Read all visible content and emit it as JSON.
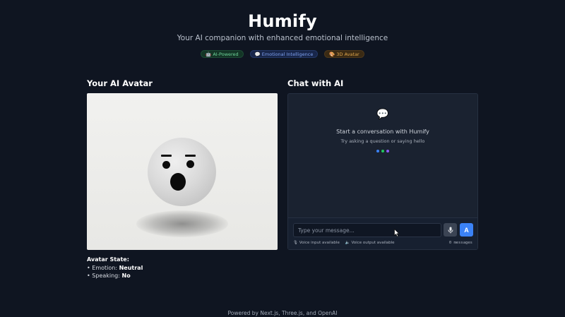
{
  "header": {
    "title": "Humify",
    "subtitle": "Your AI companion with enhanced emotional intelligence",
    "badges": [
      {
        "icon": "robot-icon",
        "glyph": "🤖",
        "label": "AI-Powered",
        "color": "#6fd39a"
      },
      {
        "icon": "speech-bubble-icon",
        "glyph": "💬",
        "label": "Emotional Intelligence",
        "color": "#7fa2f0"
      },
      {
        "icon": "palette-icon",
        "glyph": "🎨",
        "label": "3D Avatar",
        "color": "#e0a64d"
      }
    ]
  },
  "avatar": {
    "section_title": "Your AI Avatar",
    "state_heading": "Avatar State:",
    "emotion_label": "• Emotion:",
    "emotion_value": "Neutral",
    "speaking_label": "• Speaking:",
    "speaking_value": "No"
  },
  "chat": {
    "section_title": "Chat with AI",
    "empty_icon": "💬",
    "empty_title": "Start a conversation with Humify",
    "empty_subtitle": "Try asking a question or saying hello",
    "dot_colors": [
      "#3b82f6",
      "#22c55e",
      "#8b5cf6"
    ],
    "input_placeholder": "Type your message...",
    "send_label": "A",
    "voice_input": "Voice input available",
    "voice_output": "Voice output available",
    "message_count": "0 messages"
  },
  "footer": {
    "text": "Powered by Next.js, Three.js, and OpenAI"
  }
}
